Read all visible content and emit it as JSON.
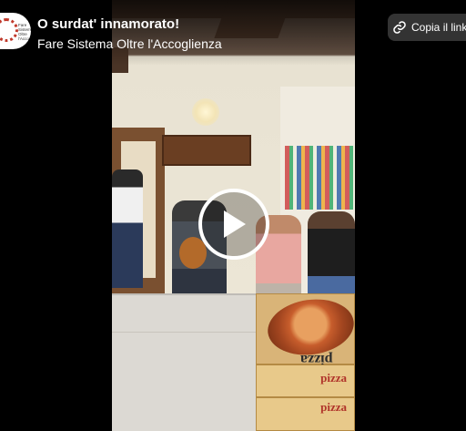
{
  "video": {
    "title": "O surdat' innamorato!",
    "page_name": "Fare Sistema Oltre l'Accoglienza",
    "avatar_text": "Fare Sistema Oltre l'Accoglienza",
    "pizza_label_1": "pizza",
    "pizza_label_2": "pizza",
    "pizza_box_text": "pizza"
  },
  "actions": {
    "copy_link_label": "Copia il link"
  },
  "icons": {
    "play": "play-icon",
    "link": "link-icon"
  },
  "colors": {
    "overlay_text": "#ffffff",
    "copy_button_bg": "#3c3c3c"
  }
}
